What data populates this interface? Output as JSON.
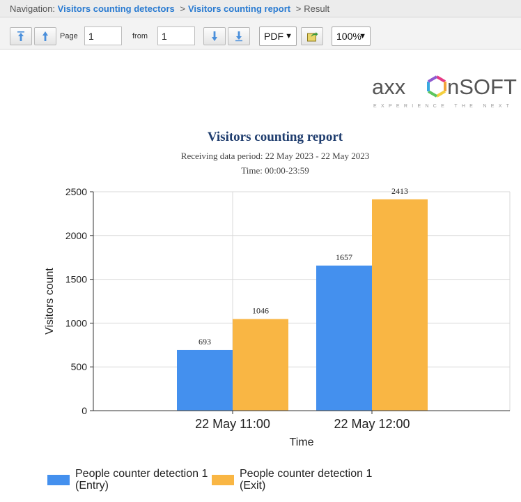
{
  "navigation": {
    "prefix": "Navigation:",
    "crumbs": [
      "Visitors counting detectors",
      "Visitors counting report"
    ],
    "current": "Result",
    "separator": ">"
  },
  "toolbar": {
    "page_label": "Page",
    "page_value": "1",
    "from_label": "from",
    "from_value": "1",
    "format": "PDF",
    "zoom": "100%",
    "icons": [
      "first-page-icon",
      "prev-page-icon",
      "next-page-icon",
      "last-page-icon",
      "export-icon"
    ]
  },
  "logo": {
    "brand_left": "axx",
    "brand_right": "nSOFT",
    "tagline": "EXPERIENCE  THE  NEXT"
  },
  "report": {
    "title": "Visitors counting report",
    "period": "Receiving data period: 22 May 2023 - 22 May 2023",
    "time": "Time: 00:00-23:59"
  },
  "colors": {
    "entry": "#4490ee",
    "exit": "#f9b644",
    "grid": "#d9d9d9",
    "axis": "#333333"
  },
  "chart_data": {
    "type": "bar",
    "title": "",
    "xlabel": "Time",
    "ylabel": "Visitors count",
    "categories": [
      "22 May 11:00",
      "22 May 12:00"
    ],
    "series": [
      {
        "name": "People counter detection 1 (Entry)",
        "values": [
          693,
          1657
        ]
      },
      {
        "name": "People counter detection 1 (Exit)",
        "values": [
          1046,
          2413
        ]
      }
    ],
    "ylim": [
      0,
      2500
    ],
    "yticks": [
      0,
      500,
      1000,
      1500,
      2000,
      2500
    ],
    "grid": true,
    "legend": "bottom"
  }
}
